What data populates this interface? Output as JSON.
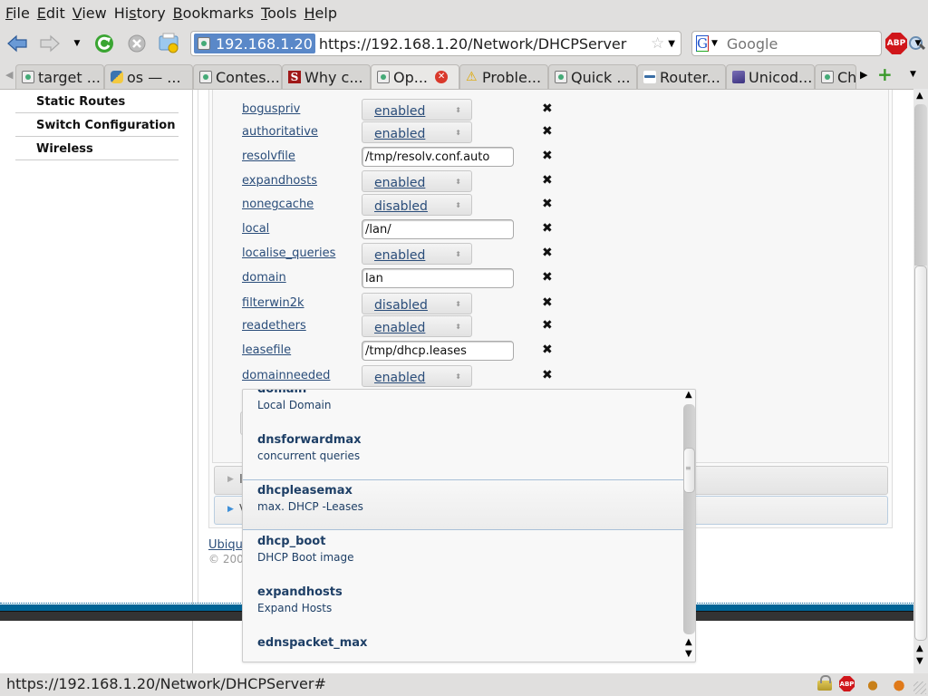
{
  "menu": [
    "File",
    "Edit",
    "View",
    "History",
    "Bookmarks",
    "Tools",
    "Help"
  ],
  "menu_accel": [
    "F",
    "E",
    "V",
    "s",
    "B",
    "T",
    "H"
  ],
  "toolbar": {
    "site_identity": "192.168.1.20",
    "url": "https://192.168.1.20/Network/DHCPServer",
    "search_placeholder": "Google",
    "search_engine_letter": "G",
    "abp_label": "ABP"
  },
  "tabs": [
    {
      "title": "target ...",
      "icon": "page"
    },
    {
      "title": "os — ...",
      "icon": "python"
    },
    {
      "title": "Contes...",
      "icon": "page"
    },
    {
      "title": "Why c...",
      "icon": "stackoverflow",
      "icon_letter": "S"
    },
    {
      "title": "Op...",
      "icon": "page",
      "active": true
    },
    {
      "title": "Proble...",
      "icon": "warning"
    },
    {
      "title": "Quick ...",
      "icon": "page"
    },
    {
      "title": "Router...",
      "icon": "router"
    },
    {
      "title": "Unicod...",
      "icon": "unicode"
    },
    {
      "title": "Ch",
      "icon": "page"
    }
  ],
  "sidebar": {
    "items": [
      {
        "label": "Static Routes"
      },
      {
        "label": "Switch Configuration"
      },
      {
        "label": "Wireless"
      }
    ]
  },
  "options": [
    {
      "name": "boguspriv",
      "type": "select",
      "value": "enabled"
    },
    {
      "name": "authoritative",
      "type": "select",
      "value": "enabled"
    },
    {
      "name": "resolvfile",
      "type": "text",
      "value": "/tmp/resolv.conf.auto"
    },
    {
      "name": "expandhosts",
      "type": "select",
      "value": "enabled"
    },
    {
      "name": "nonegcache",
      "type": "select",
      "value": "disabled"
    },
    {
      "name": "local",
      "type": "text",
      "value": "/lan/"
    },
    {
      "name": "localise_queries",
      "type": "select",
      "value": "enabled"
    },
    {
      "name": "domain",
      "type": "text",
      "value": "lan"
    },
    {
      "name": "filterwin2k",
      "type": "select",
      "value": "disabled"
    },
    {
      "name": "readethers",
      "type": "select",
      "value": "enabled"
    },
    {
      "name": "leasefile",
      "type": "text",
      "value": "/tmp/dhcp.leases"
    },
    {
      "name": "domainneeded",
      "type": "select",
      "value": "enabled"
    }
  ],
  "remove_glyph": "✖",
  "collapsibles": [
    {
      "title": "I"
    },
    {
      "title": "V"
    }
  ],
  "footer": {
    "link": "Ubiqu",
    "copyright": "© 200"
  },
  "autocomplete": {
    "items": [
      {
        "name": "domain",
        "desc": "Local Domain"
      },
      {
        "name": "dnsforwardmax",
        "desc": "concurrent queries"
      },
      {
        "name": "dhcpleasemax",
        "desc": "max. DHCP -Leases",
        "highlighted": true
      },
      {
        "name": "dhcp_boot",
        "desc": "DHCP Boot image"
      },
      {
        "name": "expandhosts",
        "desc": "Expand Hosts"
      },
      {
        "name": "ednspacket_max",
        "desc": ""
      }
    ]
  },
  "status": {
    "text": "https://192.168.1.20/Network/DHCPServer#"
  }
}
